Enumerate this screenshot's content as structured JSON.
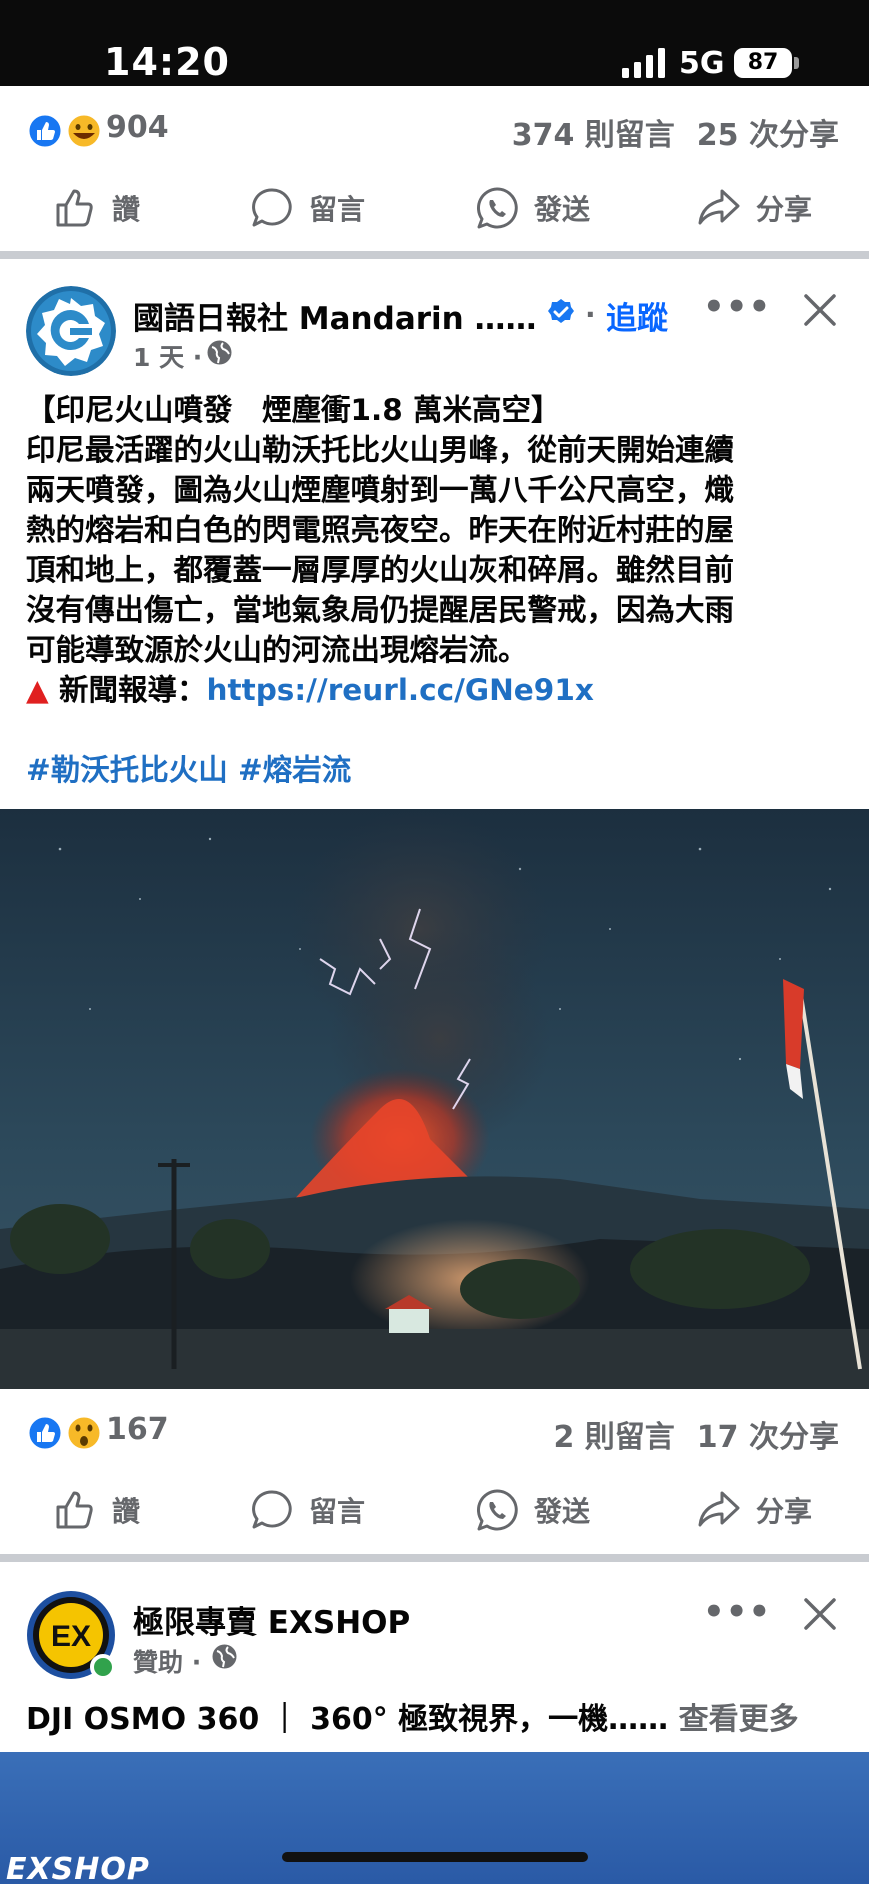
{
  "status_bar": {
    "time": "14:20",
    "network": "5G",
    "battery": "87"
  },
  "prev_post": {
    "reaction_count": "904",
    "comments": "374 則留言",
    "shares": "25 次分享"
  },
  "actions": {
    "like": "讚",
    "comment": "留言",
    "send": "發送",
    "share": "分享"
  },
  "post": {
    "page_name": "國語日報社 Mandarin ……",
    "follow": "追蹤",
    "meta": "1 天 ·",
    "text_lines": [
      "【印尼火山噴發　煙塵衝1.8 萬米高空】",
      "印尼最活躍的火山勒沃托比火山男峰，從前天開始連續",
      "兩天噴發，圖為火山煙塵噴射到一萬八千公尺高空，熾",
      "熱的熔岩和白色的閃電照亮夜空。昨天在附近村莊的屋",
      "頂和地上，都覆蓋一層厚厚的火山灰和碎屑。雖然目前",
      "沒有傳出傷亡，當地氣象局仍提醒居民警戒，因為大雨",
      "可能導致源於火山的河流出現熔岩流。"
    ],
    "news_prefix": "▲",
    "news_label": "新聞報導：",
    "news_link": "https://reurl.cc/GNe91x",
    "hashtags": "#勒沃托比火山 #熔岩流",
    "reaction_count": "167",
    "comments": "2 則留言",
    "shares": "17 次分享"
  },
  "ad": {
    "page_name": "極限專賣 EXSHOP",
    "sponsored": "贊助 ·",
    "headline": "DJI OSMO 360 ｜ 360° 極致視界，一機……",
    "see_more": "查看更多",
    "banner_brand": "EXSHOP"
  },
  "colors": {
    "accent": "#0866ff",
    "link": "#1f6fc3",
    "muted": "#65676b"
  }
}
